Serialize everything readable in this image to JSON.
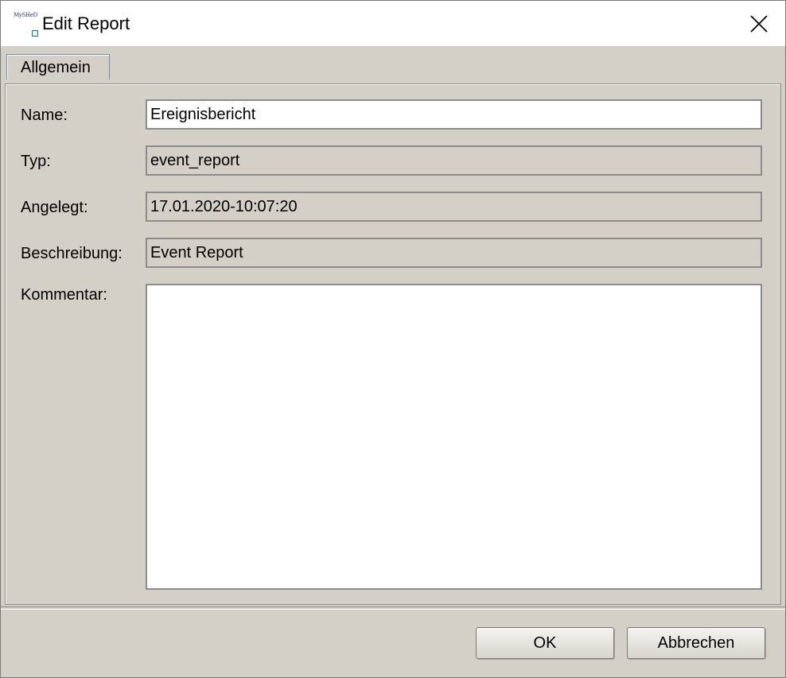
{
  "window": {
    "title": "Edit Report",
    "app_logo_text": "MySHeD"
  },
  "tabs": [
    {
      "label": "Allgemein",
      "selected": true
    }
  ],
  "form": {
    "name_label": "Name:",
    "name_value": "Ereignisbericht",
    "typ_label": "Typ:",
    "typ_value": "event_report",
    "angelegt_label": "Angelegt:",
    "angelegt_value": "17.01.2020-10:07:20",
    "beschreibung_label": "Beschreibung:",
    "beschreibung_value": "Event Report",
    "kommentar_label": "Kommentar:",
    "kommentar_value": ""
  },
  "buttons": {
    "ok_label": "OK",
    "cancel_label": "Abbrechen"
  },
  "colors": {
    "dialog_background": "#d4d0c8",
    "tab_border": "#6f8fb6",
    "field_border": "#8c8c8c"
  }
}
